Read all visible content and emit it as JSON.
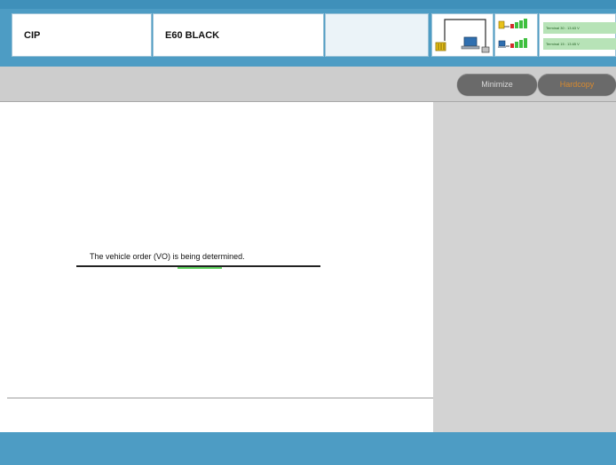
{
  "header": {
    "fields": [
      {
        "label": "CIP"
      },
      {
        "label": "E60 BLACK"
      },
      {
        "label": ""
      }
    ],
    "terminals": [
      {
        "label": "Terminal 30 : 13.63 V"
      },
      {
        "label": "Terminal 15 : 13.65 V"
      }
    ],
    "accent_color": "#4d9cc4",
    "terminal_bg_color": "#b7e3b7"
  },
  "toolbar": {
    "minimize_label": "Minimize",
    "hardcopy_label": "Hardcopy",
    "hardcopy_color": "#d98a2e"
  },
  "main": {
    "status_message": "The vehicle order (VO) is being determined."
  },
  "icons": [
    "vehicle-icon",
    "laptop-icon",
    "tester-icon",
    "signal-strength-icon"
  ]
}
